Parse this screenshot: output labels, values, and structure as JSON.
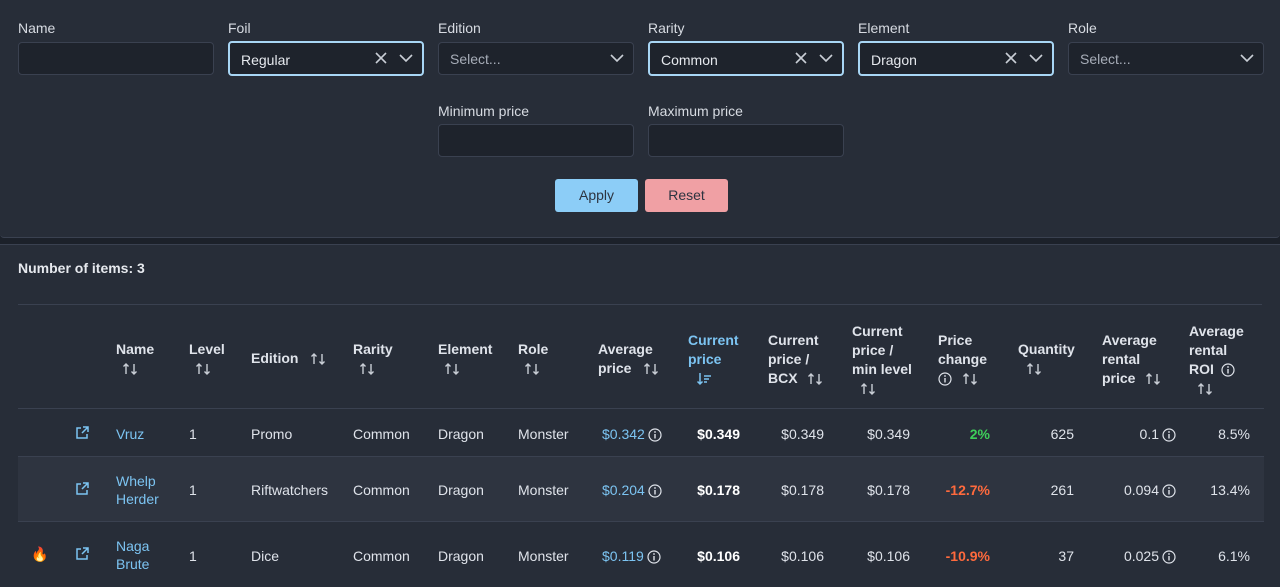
{
  "filters": {
    "name": {
      "label": "Name",
      "value": ""
    },
    "foil": {
      "label": "Foil",
      "value": "Regular"
    },
    "edition": {
      "label": "Edition",
      "placeholder": "Select..."
    },
    "rarity": {
      "label": "Rarity",
      "value": "Common"
    },
    "element": {
      "label": "Element",
      "value": "Dragon"
    },
    "role": {
      "label": "Role",
      "placeholder": "Select..."
    },
    "min_price": {
      "label": "Minimum price",
      "value": ""
    },
    "max_price": {
      "label": "Maximum price",
      "value": ""
    },
    "apply_label": "Apply",
    "reset_label": "Reset"
  },
  "results": {
    "count_text": "Number of items: 3",
    "columns": {
      "name": "Name",
      "level": "Level",
      "edition": "Edition",
      "rarity": "Rarity",
      "element": "Element",
      "role": "Role",
      "avg_price_1": "Average",
      "avg_price_2": "price",
      "cur_price_1": "Current",
      "cur_price_2": "price",
      "bcx_1": "Current",
      "bcx_2": "price /",
      "bcx_3": "BCX",
      "min_1": "Current",
      "min_2": "price /",
      "min_3": "min level",
      "change_1": "Price",
      "change_2": "change",
      "quantity": "Quantity",
      "rental_1": "Average",
      "rental_2": "rental",
      "rental_3": "price",
      "roi_1": "Average",
      "roi_2": "rental",
      "roi_3": "ROI"
    },
    "rows": [
      {
        "hot": false,
        "name1": "Vruz",
        "name2": "",
        "level": "1",
        "edition": "Promo",
        "rarity": "Common",
        "element": "Dragon",
        "role": "Monster",
        "avg_price": "$0.342",
        "cur_price": "$0.349",
        "bcx_price": "$0.349",
        "min_price": "$0.349",
        "change": "2%",
        "quantity": "625",
        "rental": "0.1",
        "roi": "8.5%"
      },
      {
        "hot": false,
        "name1": "Whelp",
        "name2": "Herder",
        "level": "1",
        "edition": "Riftwatchers",
        "rarity": "Common",
        "element": "Dragon",
        "role": "Monster",
        "avg_price": "$0.204",
        "cur_price": "$0.178",
        "bcx_price": "$0.178",
        "min_price": "$0.178",
        "change": "-12.7%",
        "quantity": "261",
        "rental": "0.094",
        "roi": "13.4%"
      },
      {
        "hot": true,
        "hot_icon": "🔥",
        "name1": "Naga",
        "name2": "Brute",
        "level": "1",
        "edition": "Dice",
        "rarity": "Common",
        "element": "Dragon",
        "role": "Monster",
        "avg_price": "$0.119",
        "cur_price": "$0.106",
        "bcx_price": "$0.106",
        "min_price": "$0.106",
        "change": "-10.9%",
        "quantity": "37",
        "rental": "0.025",
        "roi": "6.1%"
      }
    ]
  },
  "colors": {
    "accent": "#7cc4f2",
    "apply": "#8ccdf7",
    "reset": "#f0a0a4",
    "positive": "#3ecf5a",
    "negative": "#ff6a3d"
  },
  "icons": {
    "clear": "x-icon",
    "dropdown": "chevron-down-icon",
    "sort": "sort-arrows-icon",
    "sorted": "sort-desc-icon",
    "info": "info-circle-icon",
    "external": "external-link-icon",
    "hot": "fire-icon"
  }
}
